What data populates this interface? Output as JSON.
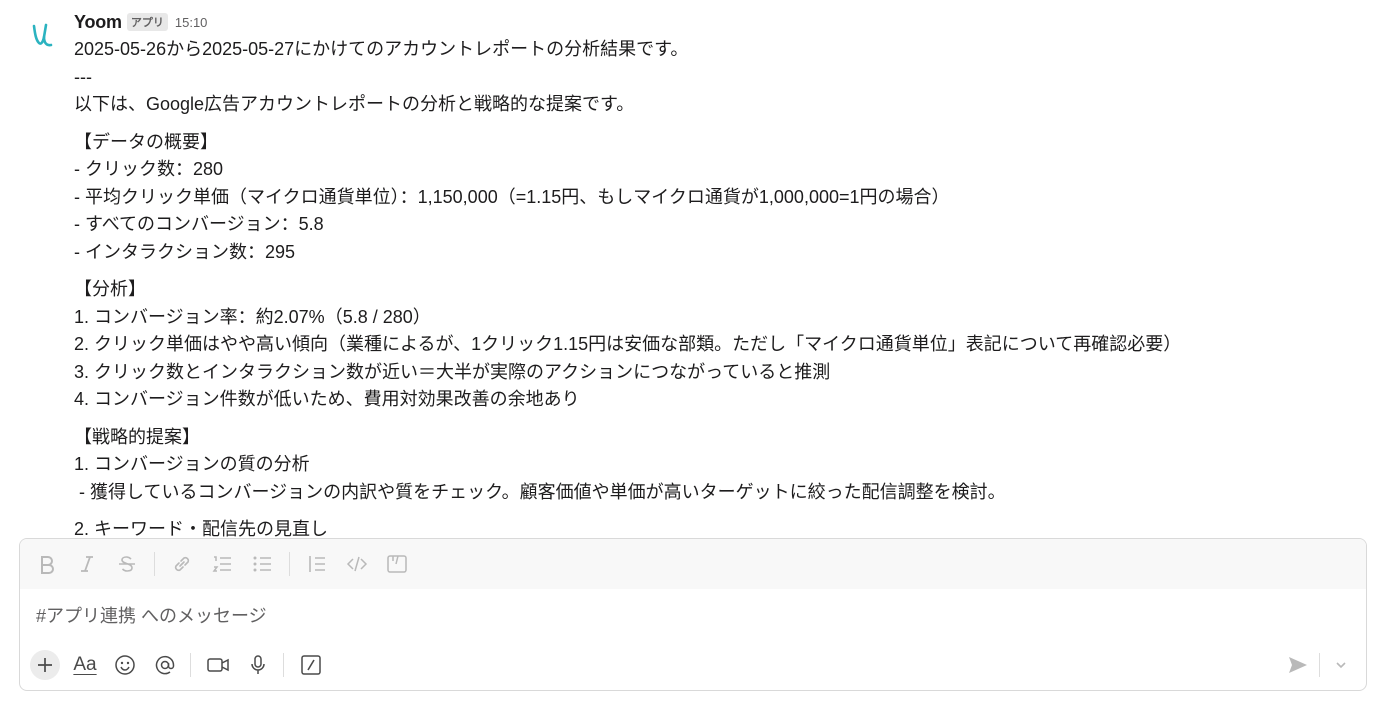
{
  "message": {
    "sender": "Yoom",
    "badge": "アプリ",
    "time": "15:10",
    "lines": [
      "2025-05-26から2025-05-27にかけてのアカウントレポートの分析結果です。",
      "---",
      "以下は、Google広告アカウントレポートの分析と戦略的な提案です。",
      "【データの概要】",
      "- クリック数：280",
      "- 平均クリック単価（マイクロ通貨単位）：1,150,000（=1.15円、もしマイクロ通貨が1,000,000=1円の場合）",
      "- すべてのコンバージョン：5.8",
      "- インタラクション数：295",
      "【分析】",
      "1. コンバージョン率：約2.07%（5.8 / 280）",
      "2. クリック単価はやや高い傾向（業種によるが、1クリック1.15円は安価な部類。ただし「マイクロ通貨単位」表記について再確認必要）",
      "3. クリック数とインタラクション数が近い＝大半が実際のアクションにつながっていると推測",
      "4. コンバージョン件数が低いため、費用対効果改善の余地あり",
      "【戦略的提案】",
      "1. コンバージョンの質の分析",
      " - 獲得しているコンバージョンの内訳や質をチェック。顧客価値や単価が高いターゲットに絞った配信調整を検討。",
      "2. キーワード・配信先の見直し"
    ]
  },
  "composer": {
    "placeholder": "#アプリ連携 へのメッセージ",
    "format_label": "Aa",
    "toolbar_icons": [
      "bold-icon",
      "italic-icon",
      "strikethrough-icon",
      "link-icon",
      "ordered-list-icon",
      "bulleted-list-icon",
      "blockquote-icon",
      "code-icon",
      "code-block-icon"
    ],
    "bottom_icons": [
      "plus-icon",
      "format-icon",
      "emoji-icon",
      "mention-icon",
      "video-icon",
      "microphone-icon",
      "slash-command-icon",
      "send-icon",
      "chevron-down-icon"
    ]
  },
  "colors": {
    "avatar_teal": "#2bb3c0",
    "text": "#1d1c1d",
    "muted": "#616061",
    "icon_disabled": "#b9b9b9"
  }
}
